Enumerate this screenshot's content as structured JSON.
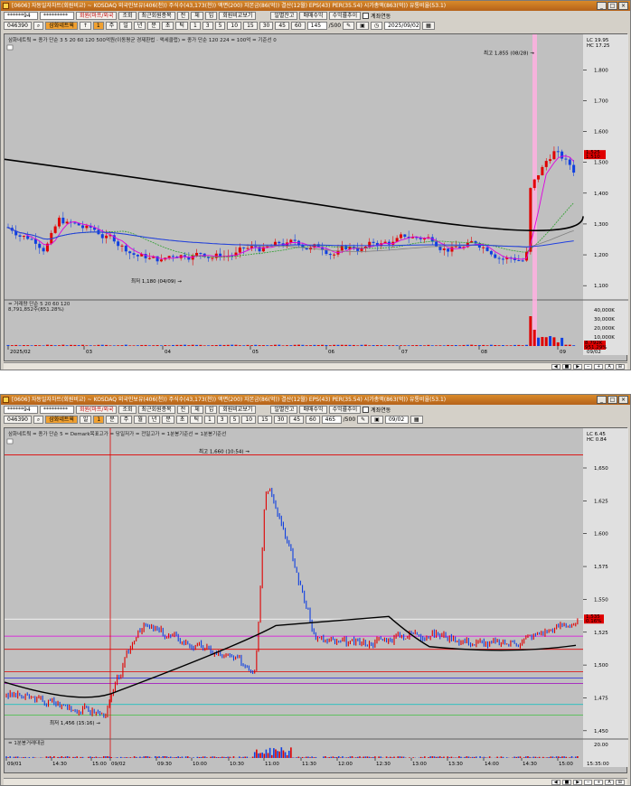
{
  "top": {
    "title": "[0606] 자동일자차트(회원비교) ~ KOSDAQ 외국인보유(406(천)) 주식수(43,173(천)) 액면(200) 자본금(86(억)) 결산(12월) EPS(43) PER(35.54) 시가총액(863(억)) 유통비율(53.1)",
    "toolbar": {
      "code_select": "******94",
      "code_select2": "*********",
      "btn_members": "회원(마프/외국",
      "btn_query": "조회",
      "btn_recent": "최근회원종목",
      "btn_all": "전",
      "btn_check": "체",
      "btn_in": "입",
      "btn_member_compare": "회원비교보기",
      "btn_daily": "일별잔고",
      "btn_trade_rate": "매매수익",
      "btn_profit": "수익률추이",
      "chk_account": "계좌연동"
    },
    "toolbar2": {
      "code": "046390",
      "name_btn": "삼화네트웍",
      "period_up": "↑",
      "period_num": "1",
      "periods": [
        "주",
        "일",
        "년",
        "분",
        "초",
        "틱"
      ],
      "minutes": [
        "1",
        "3",
        "5",
        "10",
        "15",
        "30",
        "45",
        "60"
      ],
      "count_display": "145",
      "count_total": "/500",
      "date": "2025/09/02"
    },
    "legend": "삼화네트웍 = 종가 단순 3   5   20   60   120   500억원(이동평균 경제환법 · 액세클럽) = 종가 단순 120  224 = 100억 = 기준선  0",
    "hi_label": "최고 1,855 (08/28) →",
    "lo_label": "최저 1,180 (04/09) →",
    "y_ticks": [
      "1,800",
      "1,700",
      "1,600",
      "1,500",
      "1,400",
      "1,300",
      "1,200",
      "1,100"
    ],
    "y_top_labels": [
      "LC 19.95",
      "HC 17.25"
    ],
    "price_badge": "1,525",
    "price_badge2": "1,510",
    "vol_legend": "= 거래량  단순 5   20   60   120",
    "vol_val": "8,791,852주(851.28%)",
    "vol_ticks": [
      "40,000K",
      "30,000K",
      "20,000K",
      "10,000K"
    ],
    "vol_badge": "8,792K",
    "vol_badge2": "951.29%",
    "x_labels": [
      "2025/02",
      "03",
      "04",
      "05",
      "06",
      "07",
      "08",
      "09"
    ],
    "x_right": "09/02",
    "nav_icons": [
      "◀",
      "■",
      "▶",
      "─",
      "+",
      "A",
      "⊞"
    ]
  },
  "bottom": {
    "title": "[0606] 자동일자차트(회원비교) ~ KOSDAQ 외국인보유(406(천)) 주식수(43,173(천)) 액면(200) 자본금(86(억)) 결산(12월) EPS(43) PER(35.54) 시가총액(863(억)) 유통비율(53.1)",
    "toolbar2": {
      "code": "046390",
      "name_btn": "삼화네트웍",
      "period_num": "1",
      "periods": [
        "일",
        "분",
        "주",
        "월",
        "년",
        "분",
        "초",
        "틱"
      ],
      "minutes": [
        "1",
        "3",
        "5",
        "10",
        "15",
        "30",
        "45",
        "60"
      ],
      "count_display": "465",
      "count_total": "/500",
      "date": "09/02"
    },
    "legend": "삼화네트웍 = 종가 단순 5 = Demark목표고가 = 당일저가 = 전일고가 = 1분봉기준선 = 1분봉기준선",
    "hi_label": "최고 1,660 (10:54) →",
    "lo_label": "최저 1,456 (15:16) →",
    "y_ticks": [
      "1,650",
      "1,625",
      "1,600",
      "1,575",
      "1,550",
      "1,525",
      "1,500",
      "1,475",
      "1,450"
    ],
    "y_top_labels": [
      "LC 6.45",
      "HC 0.84"
    ],
    "price_badge": "1,535",
    "price_badge2": "0.16%",
    "vol_legend": "= 1분봉거래대금",
    "vol_ticks": [
      "20.00"
    ],
    "x_labels": [
      "09/01",
      "14:30",
      "15:00",
      "09/02",
      "09:30",
      "10:00",
      "10:30",
      "11:00",
      "11:30",
      "12:00",
      "12:30",
      "13:00",
      "13:30",
      "14:00",
      "14:30",
      "15:00"
    ],
    "x_right": "15:35:00"
  },
  "colors": {
    "up": "#e00000",
    "down": "#1040e0",
    "chart_bg": "#c0c0c0",
    "title_bar": "#c8701e"
  }
}
